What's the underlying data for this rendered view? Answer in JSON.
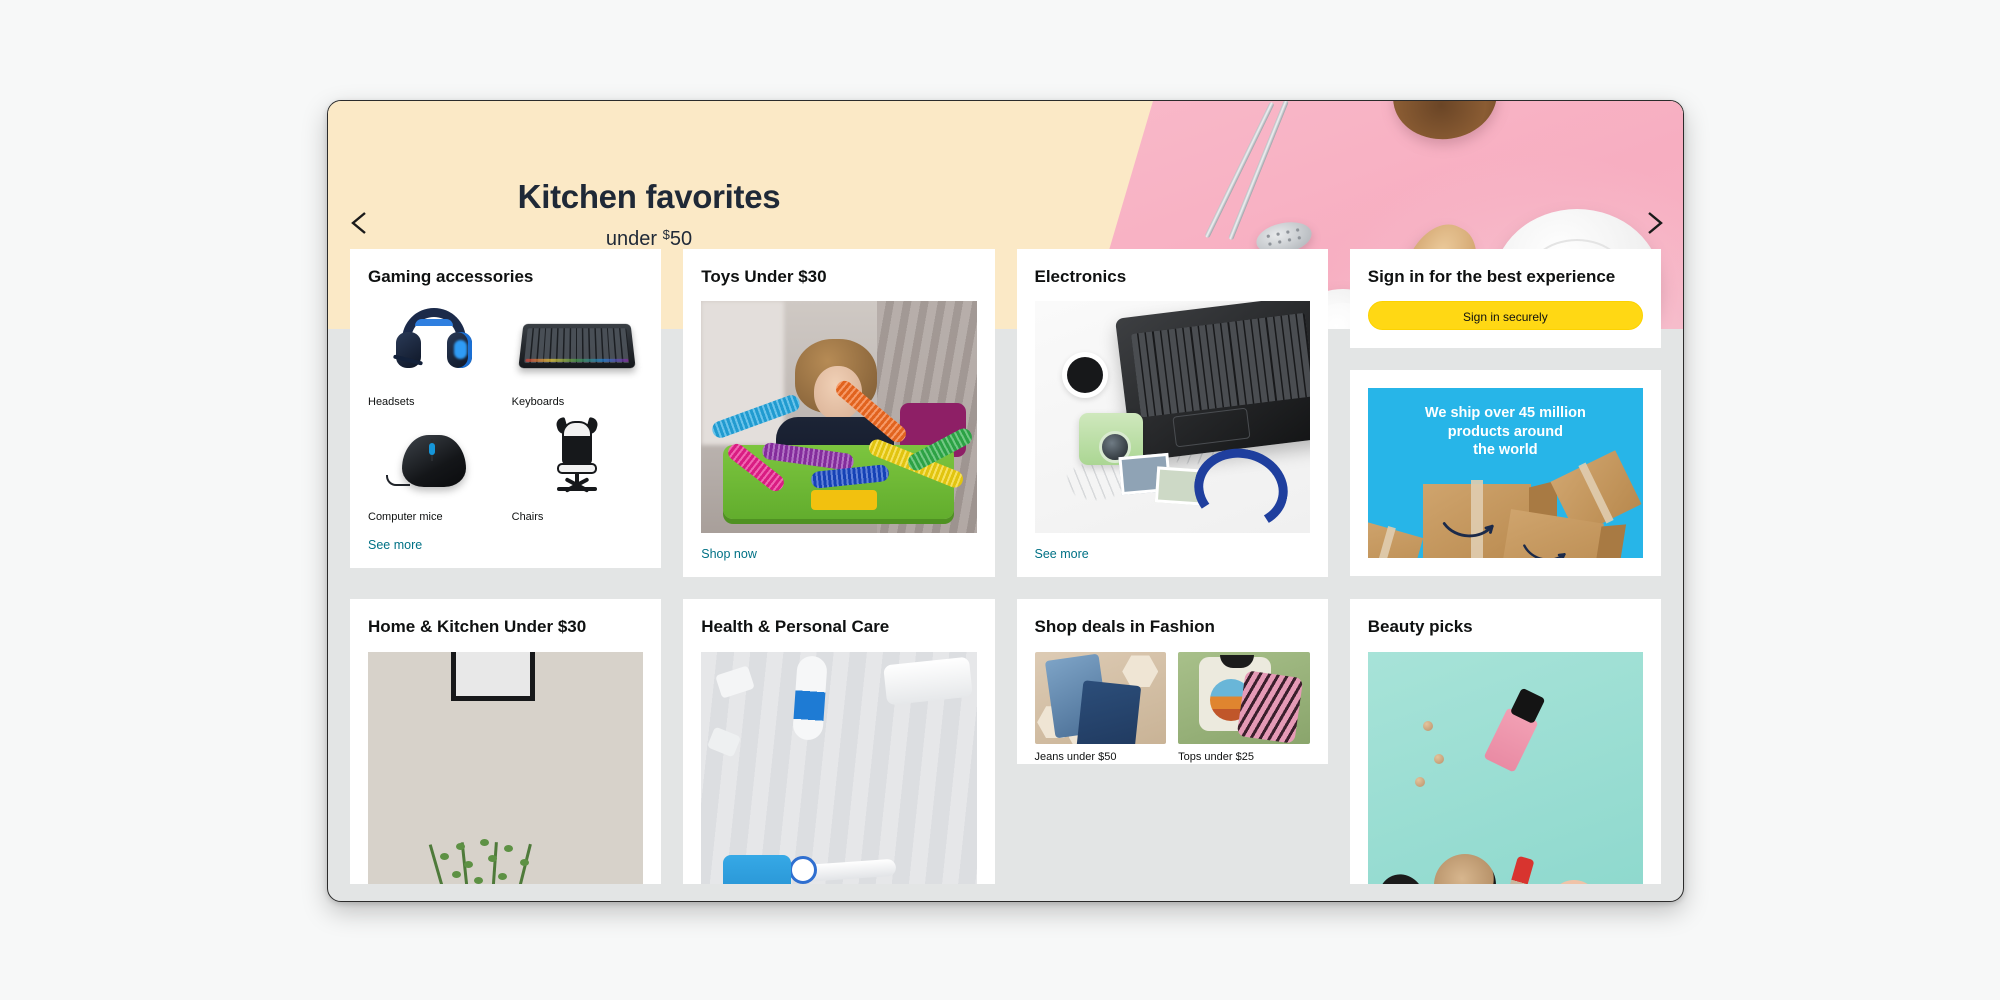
{
  "hero": {
    "title": "Kitchen favorites",
    "subtitle_prefix": "under ",
    "subtitle_currency": "$",
    "subtitle_amount": "50",
    "prev_label": "Previous",
    "next_label": "Next"
  },
  "cards": {
    "gaming": {
      "title": "Gaming accessories",
      "link": "See more",
      "tiles": [
        {
          "caption": "Headsets"
        },
        {
          "caption": "Keyboards"
        },
        {
          "caption": "Computer mice"
        },
        {
          "caption": "Chairs"
        }
      ]
    },
    "toys": {
      "title": "Toys Under $30",
      "link": "Shop now"
    },
    "electronics": {
      "title": "Electronics",
      "link": "See more"
    },
    "signin": {
      "title": "Sign in for the best experience",
      "button": "Sign in securely"
    },
    "shipping": {
      "line1": "We ship over 45 million",
      "line2": "products around",
      "line3": "the world"
    },
    "home_kitchen": {
      "title": "Home & Kitchen Under $30"
    },
    "health": {
      "title": "Health & Personal Care"
    },
    "fashion": {
      "title": "Shop deals in Fashion",
      "tiles": [
        {
          "caption": "Jeans under $50"
        },
        {
          "caption": "Tops under $25"
        }
      ]
    },
    "beauty": {
      "title": "Beauty picks"
    }
  },
  "colors": {
    "hero_bg": "#fbe9c6",
    "link": "#007185",
    "signin_button": "#ffd814",
    "shipping_bg": "#27b5e8",
    "page_gutter": "#e3e5e5"
  }
}
